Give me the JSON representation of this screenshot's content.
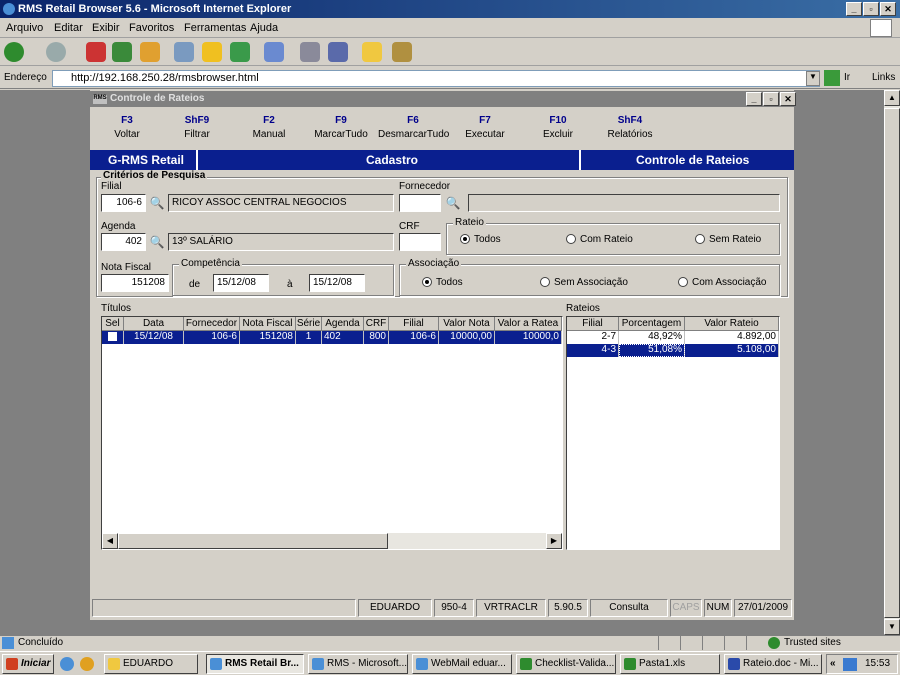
{
  "ie": {
    "title": "RMS Retail Browser 5.6 - Microsoft Internet Explorer",
    "menu": [
      "Arquivo",
      "Editar",
      "Exibir",
      "Favoritos",
      "Ferramentas",
      "Ajuda"
    ],
    "address_label": "Endereço",
    "address_url": "http://192.168.250.28/rmsbrowser.html",
    "go_label": "Ir",
    "links_label": "Links",
    "status_text": "Concluído",
    "zone_text": "Trusted sites"
  },
  "rms": {
    "title": "Controle de Rateios",
    "fkeys": [
      {
        "key": "F3",
        "label": "Voltar"
      },
      {
        "key": "ShF9",
        "label": "Filtrar"
      },
      {
        "key": "F2",
        "label": "Manual"
      },
      {
        "key": "F9",
        "label": "MarcarTudo"
      },
      {
        "key": "F6",
        "label": "DesmarcarTudo"
      },
      {
        "key": "F7",
        "label": "Executar"
      },
      {
        "key": "F10",
        "label": "Excluir"
      },
      {
        "key": "ShF4",
        "label": "Relatórios"
      }
    ],
    "band": {
      "left": "G-RMS Retail",
      "center": "Cadastro",
      "right": "Controle de Rateios"
    },
    "criteria_title": "Critérios de Pesquisa",
    "filial_label": "Filial",
    "filial_code": "106-6",
    "filial_name": "RICOY ASSOC CENTRAL NEGOCIOS",
    "fornecedor_label": "Fornecedor",
    "fornecedor_code": "",
    "fornecedor_name": "",
    "agenda_label": "Agenda",
    "agenda_code": "402",
    "agenda_name": "13º SALÁRIO",
    "crf_label": "CRF",
    "crf_value": "",
    "rateio_label": "Rateio",
    "rateio_options": [
      "Todos",
      "Com Rateio",
      "Sem Rateio"
    ],
    "nota_label": "Nota Fiscal",
    "nota_value": "151208",
    "competencia_label": "Competência",
    "de_label": "de",
    "date_from": "15/12/08",
    "a_label": "à",
    "date_to": "15/12/08",
    "associacao_label": "Associação",
    "associacao_options": [
      "Todos",
      "Sem Associação",
      "Com Associação"
    ],
    "titulos_label": "Títulos",
    "titulos_columns": [
      "Sel",
      "Data",
      "Fornecedor",
      "Nota Fiscal",
      "Série",
      "Agenda",
      "CRF",
      "Filial",
      "Valor Nota",
      "Valor a Ratea"
    ],
    "titulos_rows": [
      [
        "",
        "15/12/08",
        "106-6",
        "151208",
        "1",
        "402",
        "800",
        "106-6",
        "10000,00",
        "10000,0"
      ]
    ],
    "rateios_label": "Rateios",
    "rateios_columns": [
      "Filial",
      "Porcentagem",
      "Valor Rateio"
    ],
    "rateios_rows": [
      [
        "2-7",
        "48,92%",
        "4.892,00"
      ],
      [
        "4-3",
        "51,08%",
        "5.108,00"
      ]
    ],
    "status": [
      "EDUARDO",
      "950-4",
      "VRTRACLR",
      "5.90.5",
      "Consulta",
      "CAPS",
      "NUM",
      "27/01/2009"
    ]
  },
  "taskbar": {
    "start": "Iniciar",
    "tasks": [
      "EDUARDO",
      "RMS Retail Br...",
      "RMS - Microsoft...",
      "WebMail eduar...",
      "Checklist-Valida...",
      "Pasta1.xls",
      "Rateio.doc - Mi..."
    ],
    "tray_time": "15:53"
  }
}
